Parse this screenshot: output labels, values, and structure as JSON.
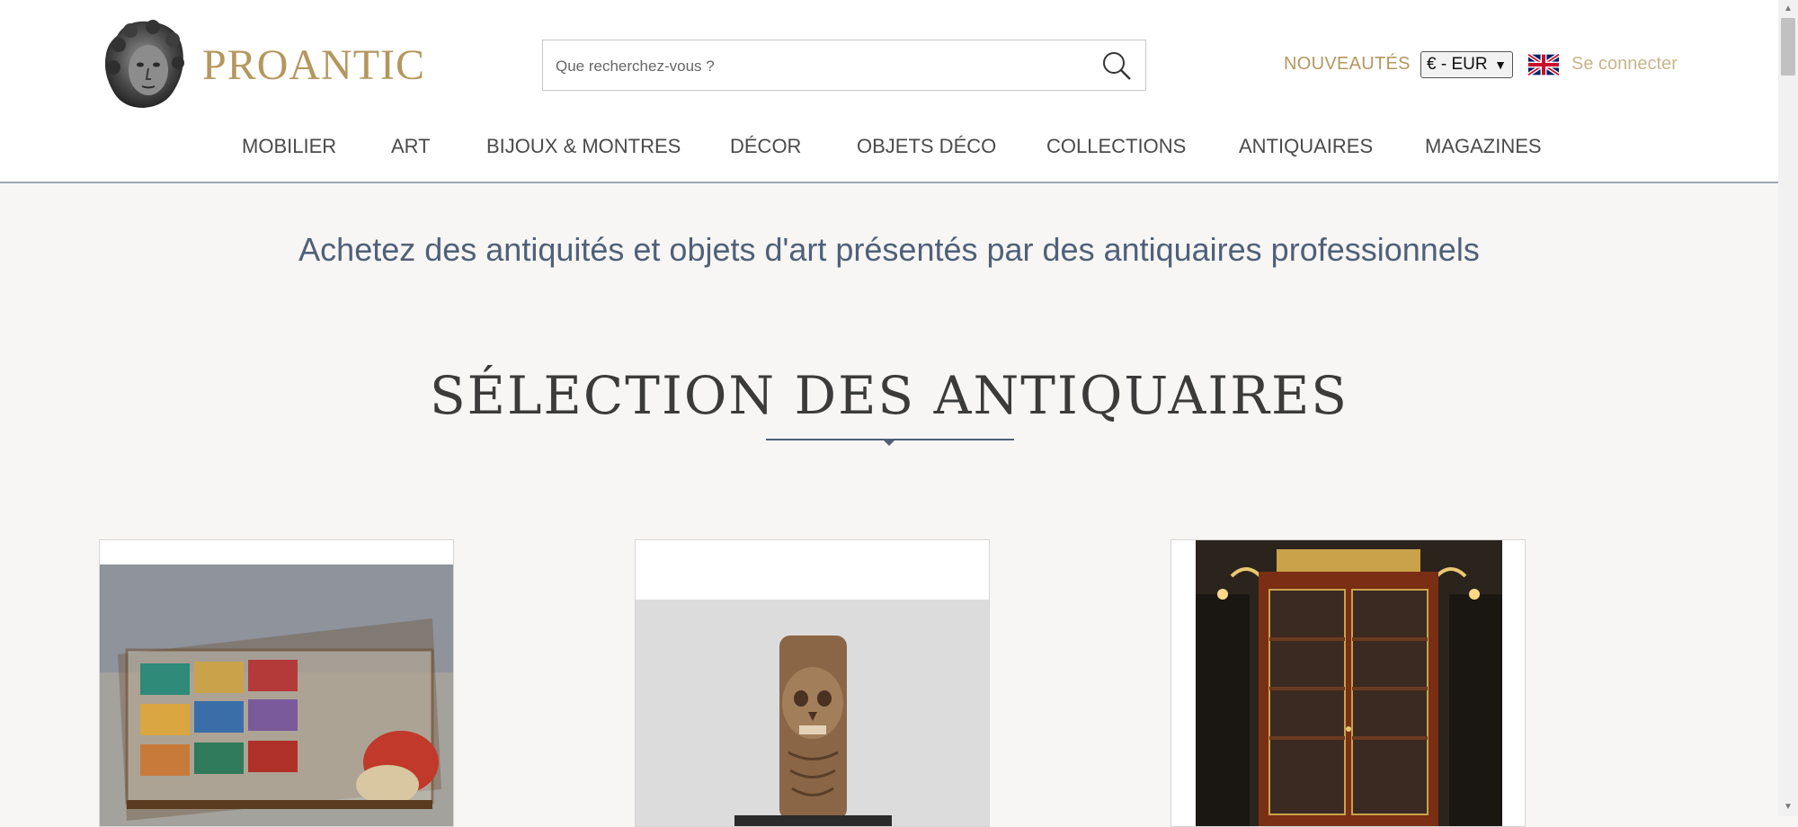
{
  "header": {
    "logo_text": "PROANTIC",
    "search": {
      "placeholder": "Que recherchez-vous ?",
      "value": ""
    },
    "nouveautes": "NOUVEAUTÉS",
    "currency": "€ - EUR",
    "login": "Se connecter"
  },
  "nav": {
    "items": [
      {
        "label": "MOBILIER"
      },
      {
        "label": "ART"
      },
      {
        "label": "BIJOUX & MONTRES"
      },
      {
        "label": "DÉCOR"
      },
      {
        "label": "OBJETS DÉCO"
      },
      {
        "label": "COLLECTIONS"
      },
      {
        "label": "ANTIQUAIRES"
      },
      {
        "label": "MAGAZINES"
      }
    ]
  },
  "main": {
    "tagline": "Achetez des antiquités et objets d'art présentés par des antiquaires professionnels",
    "section_title": "SÉLECTION DES ANTIQUAIRES"
  },
  "colors": {
    "brand_gold": "#b5975e",
    "accent_blue": "#4f6079",
    "background": "#f7f6f4"
  }
}
